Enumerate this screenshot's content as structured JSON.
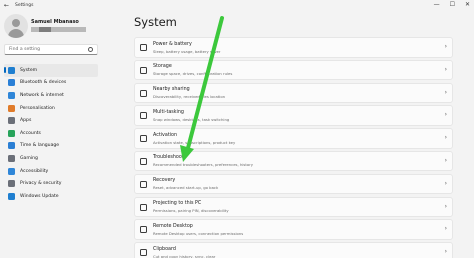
{
  "window": {
    "title": "Settings",
    "back_glyph": "←",
    "controls": [
      "—",
      "☐",
      "✕"
    ]
  },
  "profile": {
    "name": "Samuel Mbanaso"
  },
  "search": {
    "placeholder": "Find a setting"
  },
  "sidebar": {
    "items": [
      {
        "label": "System",
        "icon": "system-icon",
        "color": "#1f7fd0",
        "selected": true
      },
      {
        "label": "Bluetooth & devices",
        "icon": "bluetooth-icon",
        "color": "#2a7fd6",
        "selected": false
      },
      {
        "label": "Network & internet",
        "icon": "wifi-icon",
        "color": "#2f86d8",
        "selected": false
      },
      {
        "label": "Personalisation",
        "icon": "brush-icon",
        "color": "#e07b2a",
        "selected": false
      },
      {
        "label": "Apps",
        "icon": "apps-icon",
        "color": "#6b6f78",
        "selected": false
      },
      {
        "label": "Accounts",
        "icon": "person-icon",
        "color": "#27a35a",
        "selected": false
      },
      {
        "label": "Time & language",
        "icon": "globe-icon",
        "color": "#2b7fd4",
        "selected": false
      },
      {
        "label": "Gaming",
        "icon": "controller-icon",
        "color": "#6b6f78",
        "selected": false
      },
      {
        "label": "Accessibility",
        "icon": "accessibility-icon",
        "color": "#2f86d8",
        "selected": false
      },
      {
        "label": "Privacy & security",
        "icon": "shield-icon",
        "color": "#6b6f78",
        "selected": false
      },
      {
        "label": "Windows Update",
        "icon": "update-icon",
        "color": "#1f7fd0",
        "selected": false
      }
    ]
  },
  "main": {
    "title": "System",
    "cards": [
      {
        "title": "Power & battery",
        "subtitle": "Sleep, battery usage, battery saver",
        "icon": "power-icon"
      },
      {
        "title": "Storage",
        "subtitle": "Storage space, drives, configuration rules",
        "icon": "storage-icon"
      },
      {
        "title": "Nearby sharing",
        "subtitle": "Discoverability, received files location",
        "icon": "nearby-sharing-icon"
      },
      {
        "title": "Multi-tasking",
        "subtitle": "Snap windows, desktops, task switching",
        "icon": "multitasking-icon"
      },
      {
        "title": "Activation",
        "subtitle": "Activation state, subscriptions, product key",
        "icon": "activation-icon"
      },
      {
        "title": "Troubleshoot",
        "subtitle": "Recommended troubleshooters, preferences, history",
        "icon": "wrench-icon"
      },
      {
        "title": "Recovery",
        "subtitle": "Reset, advanced start-up, go back",
        "icon": "recovery-icon"
      },
      {
        "title": "Projecting to this PC",
        "subtitle": "Permissions, pairing PIN, discoverability",
        "icon": "projector-icon"
      },
      {
        "title": "Remote Desktop",
        "subtitle": "Remote Desktop users, connection permissions",
        "icon": "remote-desktop-icon"
      },
      {
        "title": "Clipboard",
        "subtitle": "Cut and copy history, sync, clear",
        "icon": "clipboard-icon"
      }
    ],
    "chevron": "›"
  },
  "annotation": {
    "color": "#3cc83c"
  }
}
